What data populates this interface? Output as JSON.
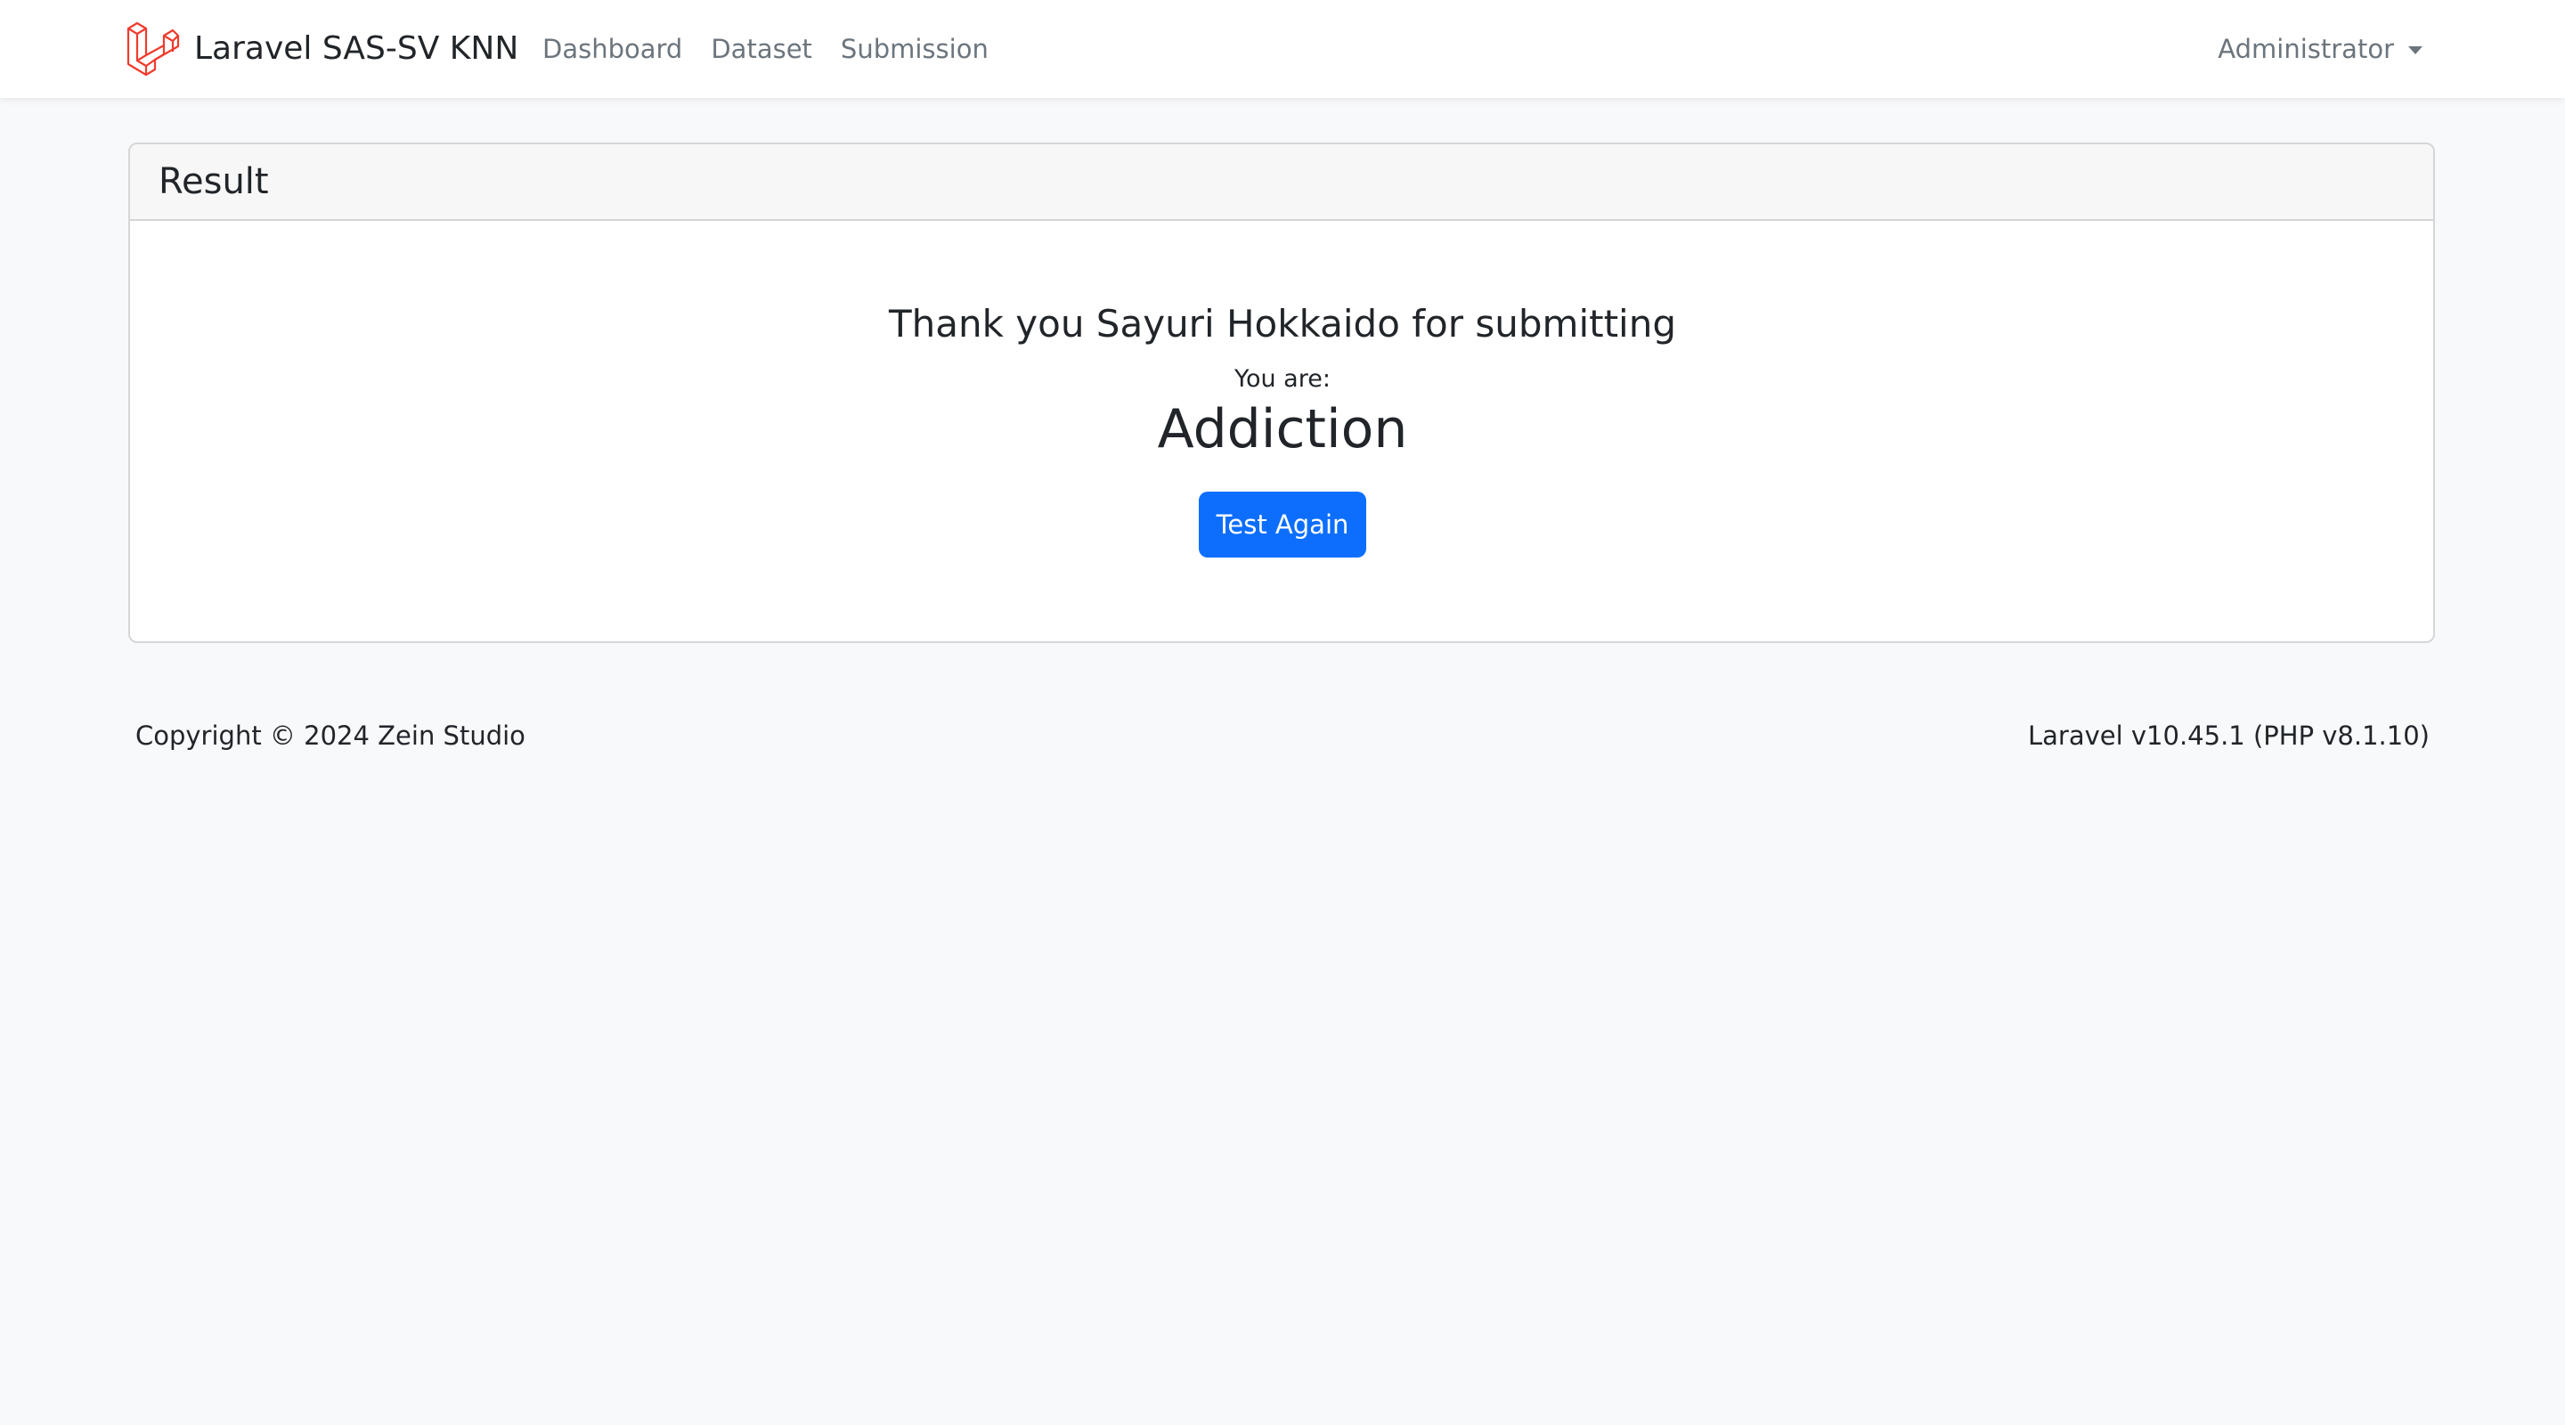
{
  "navbar": {
    "brand_name": "Laravel SAS-SV KNN",
    "brand_logo_icon": "laravel-logo-icon",
    "links": [
      {
        "label": "Dashboard"
      },
      {
        "label": "Dataset"
      },
      {
        "label": "Submission"
      }
    ],
    "user_menu_label": "Administrator"
  },
  "result_card": {
    "header_title": "Result",
    "thanks_message": "Thank you Sayuri Hokkaido for submitting",
    "you_are_label": "You are:",
    "result_value": "Addiction",
    "test_again_label": "Test Again"
  },
  "footer": {
    "copyright_prefix": "Copyright © 2024",
    "studio_name": "Zein Studio",
    "version_text": "Laravel v10.45.1 (PHP v8.1.10)"
  },
  "colors": {
    "page_background": "#f8f9fa",
    "primary_button": "#0d6efd",
    "brand_logo": "#ef3b2d"
  }
}
